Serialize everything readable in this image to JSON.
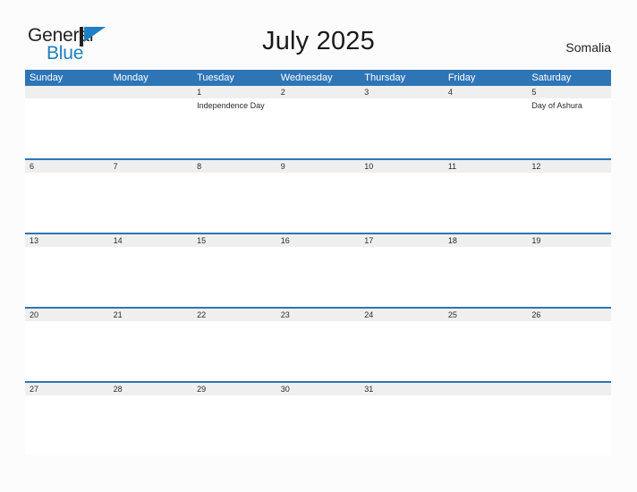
{
  "brand": {
    "name_top": "General",
    "name_bottom": "Blue",
    "flag_icon": "triangle-flag-icon",
    "flag_color": "#1f7fc4"
  },
  "header": {
    "title": "July 2025",
    "country": "Somalia"
  },
  "colors": {
    "header_blue": "#2e75b6",
    "row_rule_blue": "#2e75b6",
    "date_band_gray": "#efefef",
    "page_background": "#fcfcfc",
    "text_dark": "#231f20",
    "logo_blue": "#1f7fc4"
  },
  "calendar": {
    "day_headers": [
      "Sunday",
      "Monday",
      "Tuesday",
      "Wednesday",
      "Thursday",
      "Friday",
      "Saturday"
    ],
    "weeks": [
      {
        "days": [
          {
            "date": "",
            "events": []
          },
          {
            "date": "",
            "events": []
          },
          {
            "date": "1",
            "events": [
              "Independence Day"
            ]
          },
          {
            "date": "2",
            "events": []
          },
          {
            "date": "3",
            "events": []
          },
          {
            "date": "4",
            "events": []
          },
          {
            "date": "5",
            "events": [
              "Day of Ashura"
            ]
          }
        ]
      },
      {
        "days": [
          {
            "date": "6",
            "events": []
          },
          {
            "date": "7",
            "events": []
          },
          {
            "date": "8",
            "events": []
          },
          {
            "date": "9",
            "events": []
          },
          {
            "date": "10",
            "events": []
          },
          {
            "date": "11",
            "events": []
          },
          {
            "date": "12",
            "events": []
          }
        ]
      },
      {
        "days": [
          {
            "date": "13",
            "events": []
          },
          {
            "date": "14",
            "events": []
          },
          {
            "date": "15",
            "events": []
          },
          {
            "date": "16",
            "events": []
          },
          {
            "date": "17",
            "events": []
          },
          {
            "date": "18",
            "events": []
          },
          {
            "date": "19",
            "events": []
          }
        ]
      },
      {
        "days": [
          {
            "date": "20",
            "events": []
          },
          {
            "date": "21",
            "events": []
          },
          {
            "date": "22",
            "events": []
          },
          {
            "date": "23",
            "events": []
          },
          {
            "date": "24",
            "events": []
          },
          {
            "date": "25",
            "events": []
          },
          {
            "date": "26",
            "events": []
          }
        ]
      },
      {
        "days": [
          {
            "date": "27",
            "events": []
          },
          {
            "date": "28",
            "events": []
          },
          {
            "date": "29",
            "events": []
          },
          {
            "date": "30",
            "events": []
          },
          {
            "date": "31",
            "events": []
          },
          {
            "date": "",
            "events": []
          },
          {
            "date": "",
            "events": []
          }
        ]
      }
    ]
  }
}
